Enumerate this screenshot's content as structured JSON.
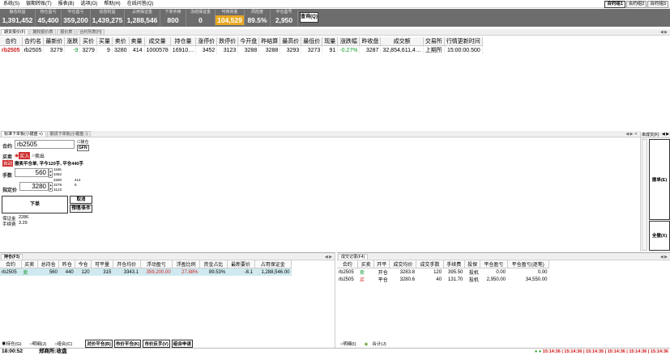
{
  "menu": [
    "系统(S)",
    "银期转账(T)",
    "报表(B)",
    "选项(O)",
    "帮助(H)",
    "在线问答(Q)"
  ],
  "layout_tabs": [
    {
      "label": "合约组1",
      "selected": true
    },
    {
      "label": "合约组2",
      "selected": false
    },
    {
      "label": "合约组3",
      "selected": false
    }
  ],
  "account": [
    {
      "key": "静态权益",
      "value": "1,391,452"
    },
    {
      "key": "持仓盈亏",
      "value": "45,400"
    },
    {
      "key": "平仓盈亏",
      "value": "359,200"
    },
    {
      "key": "动态权益",
      "value": "1,439,275"
    },
    {
      "key": "占用保证金",
      "value": "1,288,546"
    },
    {
      "key": "下单手续",
      "value": "800"
    },
    {
      "key": "冻结保证金",
      "value": "0"
    },
    {
      "key": "可用资金",
      "value": "104,529",
      "highlight": true
    },
    {
      "key": "风险度",
      "value": "89.5%"
    },
    {
      "key": "平仓盈号",
      "value": "2,950"
    }
  ],
  "query_button": "查询(Q)",
  "quote_tabs": [
    {
      "label": "期货报价(F)",
      "active": true
    },
    {
      "label": "期权报价表",
      "active": false
    },
    {
      "label": "报价表",
      "active": false
    },
    {
      "label": "合约列表(H)",
      "active": false
    }
  ],
  "quote_nav": "◀ ▶",
  "quote_table": {
    "columns": [
      "合约",
      "合约名",
      "最新价",
      "涨跌",
      "买价",
      "买量",
      "卖价",
      "卖量",
      "成交量",
      "持仓量",
      "涨停价",
      "跌停价",
      "今开盘",
      "昨结算",
      "最高价",
      "最低价",
      "现量",
      "涨跌幅",
      "昨收盘",
      "成交额",
      "交易所",
      "行情更新时间"
    ],
    "rows": [
      [
        "rb2505",
        "rb2505",
        "3279",
        "-9",
        "3279",
        "9",
        "3280",
        "414",
        "1000578",
        "16910…",
        "3452",
        "3123",
        "3288",
        "3288",
        "3293",
        "3273",
        "91",
        "-0.27%",
        "3287",
        "32,854,611,4…",
        "上期所",
        "15:00:00.500"
      ]
    ]
  },
  "order_tabs": [
    {
      "label": "标准下单板(小键盘 +)",
      "active": true
    },
    {
      "label": "期货下单板(小键盘 -)",
      "active": false
    }
  ],
  "order_tab_nav": "◀ ▶ ✕",
  "order": {
    "contract_label": "合约",
    "contract_value": "rb2505",
    "lock_label": "锁仓",
    "gfn_label": "GFN",
    "side_label": "买卖",
    "buy_label": "买入",
    "sell_label": "卖出",
    "auto_tag": "自动",
    "auto_text": "撤卖平仓单, 平今120手, 平仓440手",
    "qty_label": "手数",
    "qty_value": "560",
    "qty_hints": [
      "1166",
      "3452"
    ],
    "price_label": "指定价",
    "price_value": "3280",
    "price_hints": [
      "3280",
      "3279",
      "3123"
    ],
    "price_side": [
      "414",
      "9"
    ],
    "submit_label": "下单",
    "cancel_label": "取消",
    "condition_label": "预埋/条件",
    "margin_label": "保证金",
    "margin_value": "2286",
    "fee_label": "手续费",
    "fee_value": "3.29"
  },
  "side_panel": {
    "title": "未成交(F)",
    "nav": "◀ ▶",
    "cancel_button": "撤单(E)",
    "cancel_all_button": "全撤(X)"
  },
  "positions": {
    "tab": "持仓(F3)",
    "nav": "◀ ▶",
    "columns": [
      "合约",
      "买卖",
      "总持仓",
      "昨仓",
      "今仓",
      "可平量",
      "开仓均价",
      "浮动盈亏",
      "浮盈比例",
      "资金占比",
      "最新要价",
      "占用保证金"
    ],
    "rows": [
      [
        "rb2505",
        "卖",
        "560",
        "440",
        "120",
        "315",
        "3343.1",
        "359,200.00",
        "27.88%",
        "89.53%",
        "-8.1",
        "1,288,546.00"
      ]
    ],
    "radios": [
      "持仓(G)",
      "明细(J)",
      "组合(C)"
    ],
    "buttons": [
      "对价平仓(B)",
      "市价平仓(K)",
      "市价反手(V)",
      "组合申请"
    ]
  },
  "trades": {
    "tab": "成交记录(F4)",
    "nav": "◀ ▶",
    "columns": [
      "合约",
      "买卖",
      "开平",
      "成交均价",
      "成交手数",
      "手续费",
      "投保",
      "平仓盈亏",
      "平仓盈亏(逐笔)"
    ],
    "rows": [
      [
        "rb2505",
        "卖",
        "开仓",
        "3283.8",
        "120",
        "395.50",
        "投机",
        "0.00",
        "0.00"
      ],
      [
        "rb2505",
        "买",
        "平仓",
        "3280.6",
        "40",
        "131.70",
        "投机",
        "2,950.00",
        "34,550.00"
      ]
    ],
    "radios": [
      "明细(I)",
      "合计(J)"
    ]
  },
  "status": {
    "time": "18:00:52",
    "exchange": "郑商所:收盘",
    "clocks": [
      "15:14:36",
      "15:14:36",
      "15:14:35",
      "15:14:36",
      "15:14:36",
      "15:14:36"
    ]
  }
}
